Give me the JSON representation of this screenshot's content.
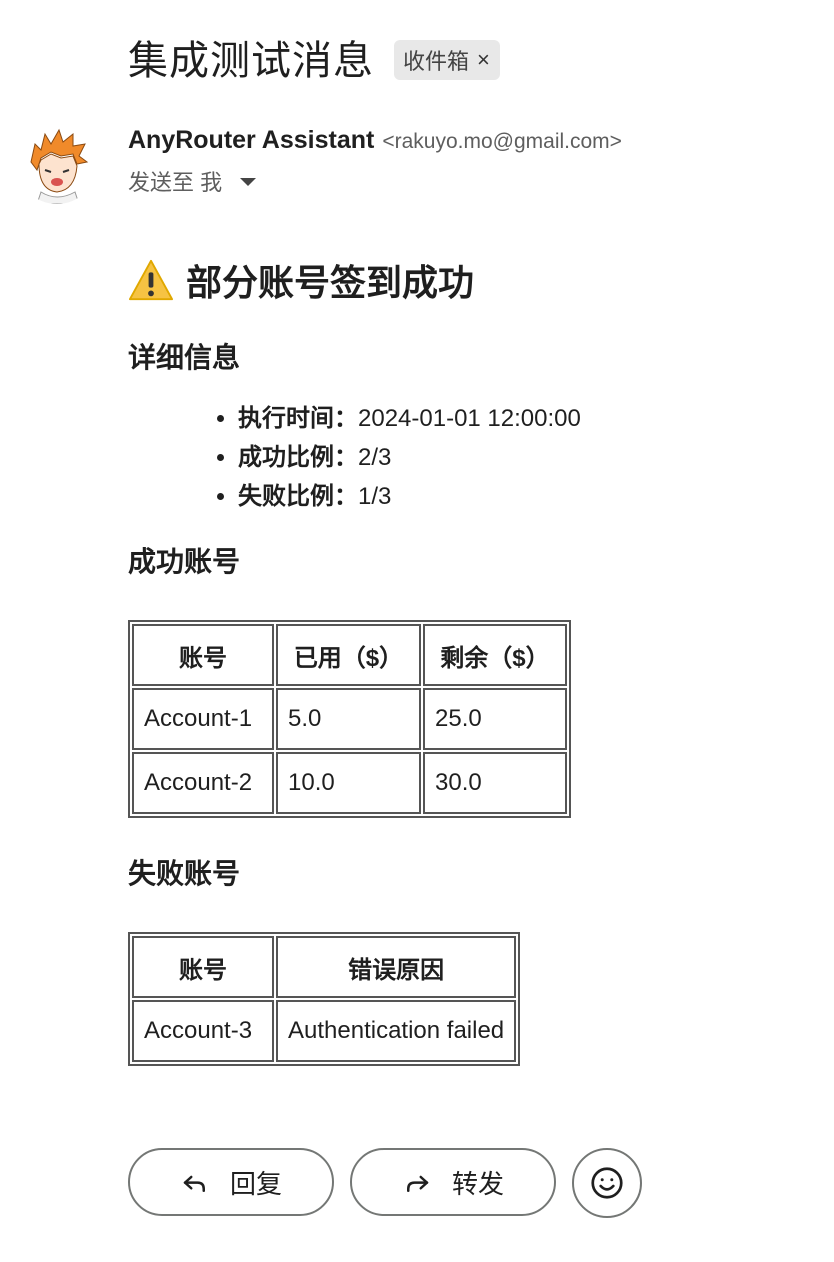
{
  "email": {
    "subject": "集成测试消息",
    "label": "收件箱",
    "label_remove": "×",
    "sender_name": "AnyRouter Assistant",
    "sender_email": "<rakuyo.mo@gmail.com>",
    "recipient": "发送至 我"
  },
  "body": {
    "title": "部分账号签到成功",
    "details_heading": "详细信息",
    "details": [
      {
        "key": "执行时间：",
        "value": "2024-01-01 12:00:00"
      },
      {
        "key": "成功比例：",
        "value": "2/3"
      },
      {
        "key": "失败比例：",
        "value": "1/3"
      }
    ],
    "success_heading": "成功账号",
    "success_table": {
      "headers": [
        "账号",
        "已用（$）",
        "剩余（$）"
      ],
      "rows": [
        [
          "Account-1",
          "5.0",
          "25.0"
        ],
        [
          "Account-2",
          "10.0",
          "30.0"
        ]
      ]
    },
    "failed_heading": "失败账号",
    "failed_table": {
      "headers": [
        "账号",
        "错误原因"
      ],
      "rows": [
        [
          "Account-3",
          "Authentication failed"
        ]
      ]
    }
  },
  "actions": {
    "reply_label": "回复",
    "forward_label": "转发"
  },
  "icons": {
    "warning": "warning-icon",
    "reply": "reply-arrow-icon",
    "forward": "forward-arrow-icon",
    "emoji": "smiley-icon",
    "caret": "caret-down-icon"
  }
}
